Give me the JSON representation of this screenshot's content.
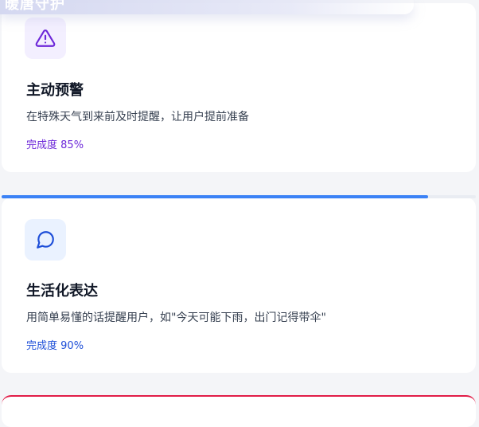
{
  "header": {
    "partial_title": "暖唐守护"
  },
  "cards": [
    {
      "icon": "alert-triangle-icon",
      "title": "主动预警",
      "description": "在特殊天气到来前及时提醒，让用户提前准备",
      "progress_label": "完成度",
      "progress_text": "85%",
      "progress_value": 85,
      "accent": "#6d28d9"
    },
    {
      "icon": "message-circle-icon",
      "title": "生活化表达",
      "description": "用简单易懂的话提醒用户，如\"今天可能下雨，出门记得带伞\"",
      "progress_label": "完成度",
      "progress_text": "90%",
      "progress_value": 90,
      "accent": "#1d4ed8"
    }
  ],
  "separator_progress": 90,
  "colors": {
    "progress_fill": "#3b82f6",
    "next_card_accent": "#e11d48"
  }
}
